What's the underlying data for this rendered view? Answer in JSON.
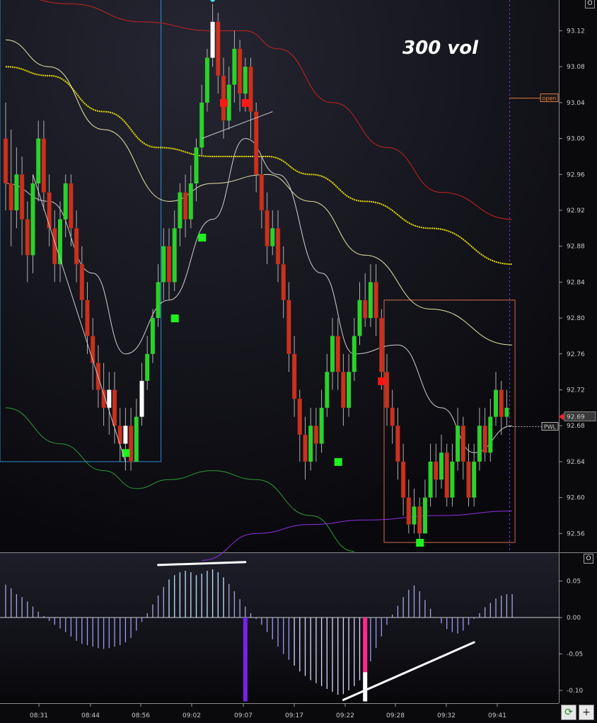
{
  "chart_data": [
    {
      "type": "candlestick",
      "title": "300 vol",
      "ylim": [
        92.53,
        93.16
      ],
      "y_ticks": [
        "93.12",
        "93.08",
        "93.04",
        "93.00",
        "92.96",
        "92.92",
        "92.88",
        "92.84",
        "92.80",
        "92.76",
        "92.72",
        "92.68",
        "92.64",
        "92.60",
        "92.56"
      ],
      "last_price": "92.69",
      "levels": [
        {
          "name": "open",
          "value": 93.045
        },
        {
          "name": "PWL",
          "value": 92.679
        }
      ],
      "candles": [
        [
          93.0,
          92.95,
          93.04,
          92.92
        ],
        [
          92.95,
          92.92,
          93.01,
          92.88
        ],
        [
          92.92,
          92.96,
          92.99,
          92.9
        ],
        [
          92.96,
          92.91,
          92.98,
          92.87
        ],
        [
          92.91,
          92.87,
          92.93,
          92.84
        ],
        [
          92.87,
          92.95,
          92.96,
          92.85
        ],
        [
          92.95,
          93.0,
          93.02,
          92.93
        ],
        [
          93.0,
          92.94,
          93.02,
          92.92
        ],
        [
          92.94,
          92.9,
          92.96,
          92.88
        ],
        [
          92.9,
          92.86,
          92.92,
          92.84
        ],
        [
          92.86,
          92.91,
          92.93,
          92.84
        ],
        [
          92.91,
          92.95,
          92.96,
          92.89
        ],
        [
          92.95,
          92.9,
          92.96,
          92.88
        ],
        [
          92.9,
          92.86,
          92.92,
          92.84
        ],
        [
          92.86,
          92.82,
          92.88,
          92.8
        ],
        [
          92.82,
          92.78,
          92.84,
          92.76
        ],
        [
          92.78,
          92.75,
          92.8,
          92.72
        ],
        [
          92.75,
          92.72,
          92.77,
          92.7
        ],
        [
          92.72,
          92.7,
          92.75,
          92.68
        ],
        [
          92.7,
          92.72,
          92.74,
          92.67
        ],
        [
          92.72,
          92.68,
          92.74,
          92.66
        ],
        [
          92.68,
          92.66,
          92.7,
          92.64
        ],
        [
          92.66,
          92.68,
          92.7,
          92.63
        ],
        [
          92.68,
          92.64,
          92.7,
          92.63
        ],
        [
          92.64,
          92.69,
          92.71,
          92.64
        ],
        [
          92.69,
          92.73,
          92.75,
          92.68
        ],
        [
          92.73,
          92.76,
          92.78,
          92.72
        ],
        [
          92.76,
          92.8,
          92.81,
          92.75
        ],
        [
          92.8,
          92.84,
          92.86,
          92.79
        ],
        [
          92.84,
          92.88,
          92.9,
          92.82
        ],
        [
          92.88,
          92.84,
          92.9,
          92.82
        ],
        [
          92.84,
          92.9,
          92.92,
          92.83
        ],
        [
          92.9,
          92.94,
          92.95,
          92.88
        ],
        [
          92.94,
          92.91,
          92.96,
          92.89
        ],
        [
          92.91,
          92.95,
          92.97,
          92.9
        ],
        [
          92.95,
          92.99,
          93.0,
          92.93
        ],
        [
          92.99,
          93.04,
          93.06,
          92.98
        ],
        [
          93.04,
          93.09,
          93.1,
          93.03
        ],
        [
          93.09,
          93.13,
          93.15,
          93.08
        ],
        [
          93.13,
          93.07,
          93.14,
          93.05
        ],
        [
          93.07,
          93.02,
          93.09,
          93.0
        ],
        [
          93.02,
          93.06,
          93.08,
          93.01
        ],
        [
          93.06,
          93.1,
          93.12,
          93.04
        ],
        [
          93.1,
          93.05,
          93.11,
          93.03
        ],
        [
          93.05,
          93.08,
          93.09,
          93.03
        ],
        [
          93.08,
          93.03,
          93.09,
          93.0
        ],
        [
          93.03,
          92.96,
          93.04,
          92.94
        ],
        [
          92.96,
          92.92,
          92.98,
          92.9
        ],
        [
          92.92,
          92.88,
          92.94,
          92.86
        ],
        [
          92.88,
          92.9,
          92.92,
          92.87
        ],
        [
          92.9,
          92.86,
          92.92,
          92.84
        ],
        [
          92.86,
          92.82,
          92.88,
          92.8
        ],
        [
          92.82,
          92.76,
          92.84,
          92.74
        ],
        [
          92.76,
          92.71,
          92.78,
          92.69
        ],
        [
          92.71,
          92.67,
          92.72,
          92.64
        ],
        [
          92.67,
          92.64,
          92.69,
          92.62
        ],
        [
          92.64,
          92.68,
          92.7,
          92.63
        ],
        [
          92.68,
          92.66,
          92.7,
          92.64
        ],
        [
          92.66,
          92.7,
          92.72,
          92.65
        ],
        [
          92.7,
          92.74,
          92.76,
          92.69
        ],
        [
          92.74,
          92.78,
          92.8,
          92.72
        ],
        [
          92.78,
          92.74,
          92.8,
          92.72
        ],
        [
          92.74,
          92.7,
          92.76,
          92.68
        ],
        [
          92.7,
          92.74,
          92.76,
          92.69
        ],
        [
          92.74,
          92.78,
          92.8,
          92.73
        ],
        [
          92.78,
          92.82,
          92.84,
          92.77
        ],
        [
          92.82,
          92.8,
          92.85,
          92.79
        ],
        [
          92.8,
          92.84,
          92.86,
          92.79
        ],
        [
          92.84,
          92.8,
          92.86,
          92.78
        ],
        [
          92.8,
          92.74,
          92.81,
          92.72
        ],
        [
          92.74,
          92.7,
          92.76,
          92.68
        ],
        [
          92.7,
          92.68,
          92.72,
          92.66
        ],
        [
          92.68,
          92.64,
          92.7,
          92.62
        ],
        [
          92.64,
          92.6,
          92.66,
          92.58
        ],
        [
          92.6,
          92.57,
          92.62,
          92.56
        ],
        [
          92.57,
          92.59,
          92.61,
          92.56
        ],
        [
          92.59,
          92.56,
          92.6,
          92.55
        ],
        [
          92.56,
          92.6,
          92.62,
          92.56
        ],
        [
          92.6,
          92.64,
          92.66,
          92.59
        ],
        [
          92.64,
          92.62,
          92.66,
          92.6
        ],
        [
          92.62,
          92.65,
          92.67,
          92.61
        ],
        [
          92.65,
          92.6,
          92.66,
          92.59
        ],
        [
          92.6,
          92.64,
          92.66,
          92.59
        ],
        [
          92.64,
          92.68,
          92.7,
          92.63
        ],
        [
          92.68,
          92.64,
          92.69,
          92.62
        ],
        [
          92.64,
          92.6,
          92.66,
          92.59
        ],
        [
          92.6,
          92.64,
          92.66,
          92.59
        ],
        [
          92.64,
          92.68,
          92.7,
          92.63
        ],
        [
          92.68,
          92.65,
          92.7,
          92.64
        ],
        [
          92.65,
          92.69,
          92.71,
          92.64
        ],
        [
          92.69,
          92.72,
          92.74,
          92.68
        ],
        [
          92.72,
          92.69,
          92.73,
          92.67
        ],
        [
          92.69,
          92.7,
          92.72,
          92.68
        ]
      ],
      "white_candles": [
        19,
        22,
        25,
        38
      ],
      "buy_markers": [
        [
          22,
          92.65
        ],
        [
          31,
          92.8
        ],
        [
          36,
          92.89
        ],
        [
          61,
          92.64
        ],
        [
          76,
          92.55
        ]
      ],
      "sell_markers": [
        [
          40,
          93.04
        ],
        [
          44,
          93.04
        ],
        [
          69,
          92.73
        ]
      ],
      "moving_averages": [
        {
          "color": "#c8221e",
          "values": [
            [
              0,
              93.16
            ],
            [
              12,
              93.15
            ],
            [
              25,
              93.13
            ],
            [
              38,
              93.12
            ],
            [
              44,
              93.12
            ],
            [
              50,
              93.1
            ],
            [
              60,
              93.04
            ],
            [
              70,
              92.99
            ],
            [
              80,
              92.94
            ],
            [
              93,
              92.91
            ]
          ]
        },
        {
          "color": "#e6e000",
          "dotted": true,
          "values": [
            [
              0,
              93.08
            ],
            [
              8,
              93.07
            ],
            [
              18,
              93.03
            ],
            [
              28,
              92.99
            ],
            [
              38,
              92.98
            ],
            [
              48,
              92.98
            ],
            [
              56,
              92.96
            ],
            [
              66,
              92.93
            ],
            [
              78,
              92.9
            ],
            [
              93,
              92.86
            ]
          ]
        },
        {
          "color": "#e8e6a8",
          "values": [
            [
              0,
              93.11
            ],
            [
              8,
              93.08
            ],
            [
              18,
              93.01
            ],
            [
              30,
              92.93
            ],
            [
              38,
              92.95
            ],
            [
              48,
              92.96
            ],
            [
              56,
              92.93
            ],
            [
              66,
              92.87
            ],
            [
              78,
              92.81
            ],
            [
              93,
              92.77
            ]
          ]
        },
        {
          "color": "#d0d0d0",
          "values": [
            [
              0,
              92.95
            ],
            [
              8,
              92.93
            ],
            [
              16,
              92.85
            ],
            [
              22,
              92.76
            ],
            [
              30,
              92.82
            ],
            [
              38,
              92.91
            ],
            [
              44,
              93.0
            ],
            [
              50,
              92.96
            ],
            [
              58,
              92.85
            ],
            [
              64,
              92.76
            ],
            [
              72,
              92.77
            ],
            [
              80,
              92.7
            ],
            [
              86,
              92.65
            ],
            [
              93,
              92.68
            ]
          ]
        },
        {
          "color": "#2e9a3a",
          "values": [
            [
              0,
              92.7
            ],
            [
              10,
              92.66
            ],
            [
              18,
              92.63
            ],
            [
              24,
              92.61
            ],
            [
              30,
              92.62
            ],
            [
              38,
              92.63
            ],
            [
              46,
              92.62
            ],
            [
              56,
              92.58
            ],
            [
              64,
              92.54
            ]
          ]
        },
        {
          "color": "#8a30e0",
          "values": [
            [
              36,
              92.53
            ],
            [
              46,
              92.56
            ],
            [
              56,
              92.57
            ],
            [
              66,
              92.575
            ],
            [
              80,
              92.58
            ],
            [
              93,
              92.585
            ]
          ]
        }
      ],
      "trend_lines": [
        {
          "from": [
            5,
            92.96
          ],
          "to": [
            22,
            92.64
          ]
        },
        {
          "from": [
            36,
            93.0
          ],
          "to": [
            49,
            93.03
          ]
        }
      ],
      "zones": [
        {
          "from_index": -1,
          "to_index": 28,
          "top": 93.17,
          "bottom": 92.64,
          "color": "#2a8fcf"
        },
        {
          "from_index": 70,
          "to_index": 93,
          "top": 92.82,
          "bottom": 92.55,
          "color": "#d46a4a"
        }
      ]
    },
    {
      "type": "bar",
      "name": "oscillator",
      "ylim": [
        -0.115,
        0.07
      ],
      "y_ticks": [
        "0.05",
        "0.00",
        "-0.05",
        "-0.10"
      ],
      "x_ticks": [
        "08:31",
        "08:44",
        "08:56",
        "09:02",
        "09:07",
        "09:17",
        "09:22",
        "09:28",
        "09:32",
        "09:41"
      ],
      "values": [
        0.045,
        0.04,
        0.032,
        0.028,
        0.022,
        0.015,
        0.008,
        0.002,
        -0.005,
        -0.01,
        -0.015,
        -0.02,
        -0.026,
        -0.032,
        -0.036,
        -0.038,
        -0.04,
        -0.042,
        -0.043,
        -0.042,
        -0.04,
        -0.038,
        -0.034,
        -0.028,
        -0.018,
        -0.006,
        0.006,
        0.018,
        0.03,
        0.042,
        0.052,
        0.058,
        0.062,
        0.064,
        0.062,
        0.058,
        0.06,
        0.064,
        0.066,
        0.062,
        0.055,
        0.046,
        0.036,
        0.025,
        0.015,
        0.006,
        -0.002,
        -0.01,
        -0.02,
        -0.03,
        -0.04,
        -0.05,
        -0.058,
        -0.066,
        -0.074,
        -0.08,
        -0.086,
        -0.09,
        -0.094,
        -0.098,
        -0.102,
        -0.106,
        -0.105,
        -0.1,
        -0.094,
        -0.086,
        -0.075,
        -0.06,
        -0.042,
        -0.026,
        -0.01,
        0.004,
        0.016,
        0.028,
        0.038,
        0.044,
        0.036,
        0.024,
        0.012,
        0.0,
        -0.008,
        -0.016,
        -0.02,
        -0.022,
        -0.018,
        -0.01,
        -0.002,
        0.006,
        0.014,
        0.02,
        0.026,
        0.03,
        0.032,
        0.032
      ],
      "highlight_bars": [
        {
          "index": 44,
          "from": 0.0,
          "to": -0.115,
          "color": "#7a22e8"
        },
        {
          "index": 66,
          "from": 0.0,
          "to": -0.075,
          "color": "#ff2a8a"
        },
        {
          "index": 66,
          "from": -0.075,
          "to": -0.115,
          "color": "#ffffff"
        }
      ],
      "trend_lines": [
        {
          "from": [
            28,
            0.072
          ],
          "to": [
            44,
            0.076
          ]
        },
        {
          "from": [
            62,
            -0.113
          ],
          "to": [
            86,
            -0.034
          ]
        }
      ]
    }
  ],
  "ui": {
    "top_button": "O",
    "osc_button": "O",
    "refresh_icon": "refresh-icon",
    "add_button": "+"
  }
}
